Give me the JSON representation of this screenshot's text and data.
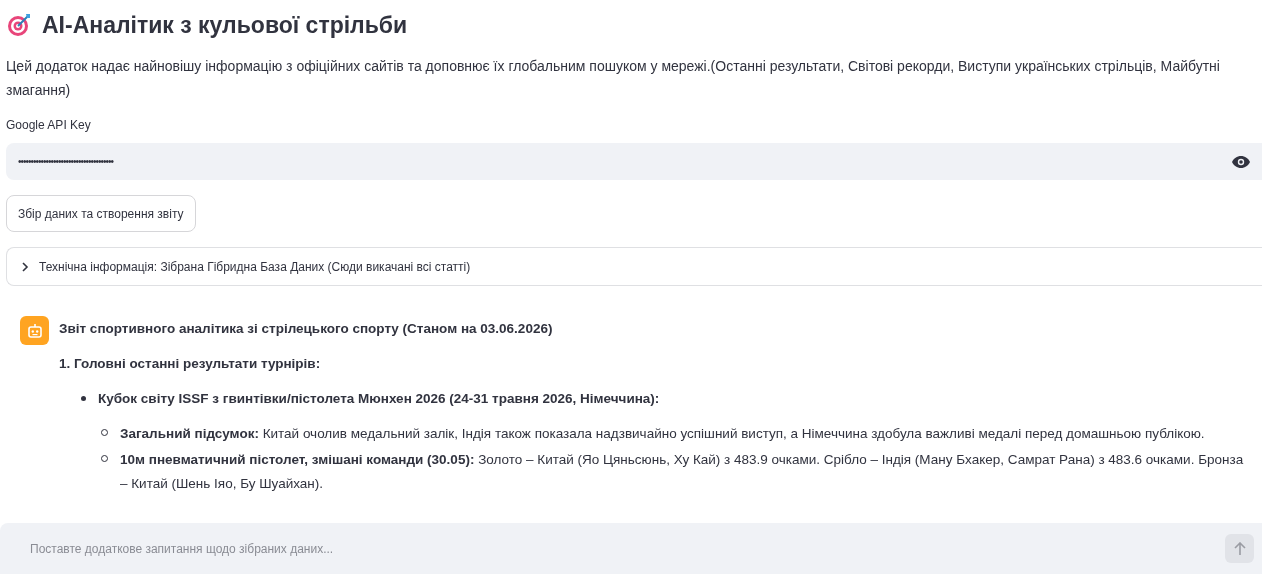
{
  "title": "AI-Аналітик з кульової стрільби",
  "description": "Цей додаток надає найновішу інформацію з офіційних сайтів та доповнює їх глобальним пошуком у мережі.(Останні результати, Світові рекорди, Виступи українських стрільців, Майбутні змагання)",
  "api_key": {
    "label": "Google API Key",
    "value": "••••••••••••••••••••••••••••••••••••••",
    "masked": true
  },
  "generate_button": "Збір даних та створення звіту",
  "expander": {
    "label": "Технічна інформація: Зібрана Гібридна База Даних (Сюди викачані всі статті)",
    "expanded": false
  },
  "message": {
    "title": "Звіт спортивного аналітика зі стрілецького спорту (Станом на 03.06.2026)",
    "heading": "1. Головні останні результати турнірів:",
    "items": [
      {
        "text": "Кубок світу ISSF з гвинтівки/пістолета Мюнхен 2026 (24-31 травня 2026, Німеччина):",
        "children": [
          {
            "text": "**Загальний підсумок:** Китай очолив медальний залік, Індія також показала надзвичайно успішний виступ, а Німеччина здобула важливі медалі перед домашньою публікою."
          },
          {
            "text": "**10м пневматичний пістолет, змішані команди (30.05):** Золото – Китай (Яо Цяньсюнь, Ху Кай) з 483.9 очками. Срібло – Індія (Ману Бхакер, Самрат Рана) з 483.6 очками. Бронза – Китай (Шень Іяо, Бу Шуайхан)."
          }
        ]
      }
    ]
  },
  "chat_input": {
    "placeholder": "Поставте додаткове запитання щодо зібраних даних..."
  }
}
